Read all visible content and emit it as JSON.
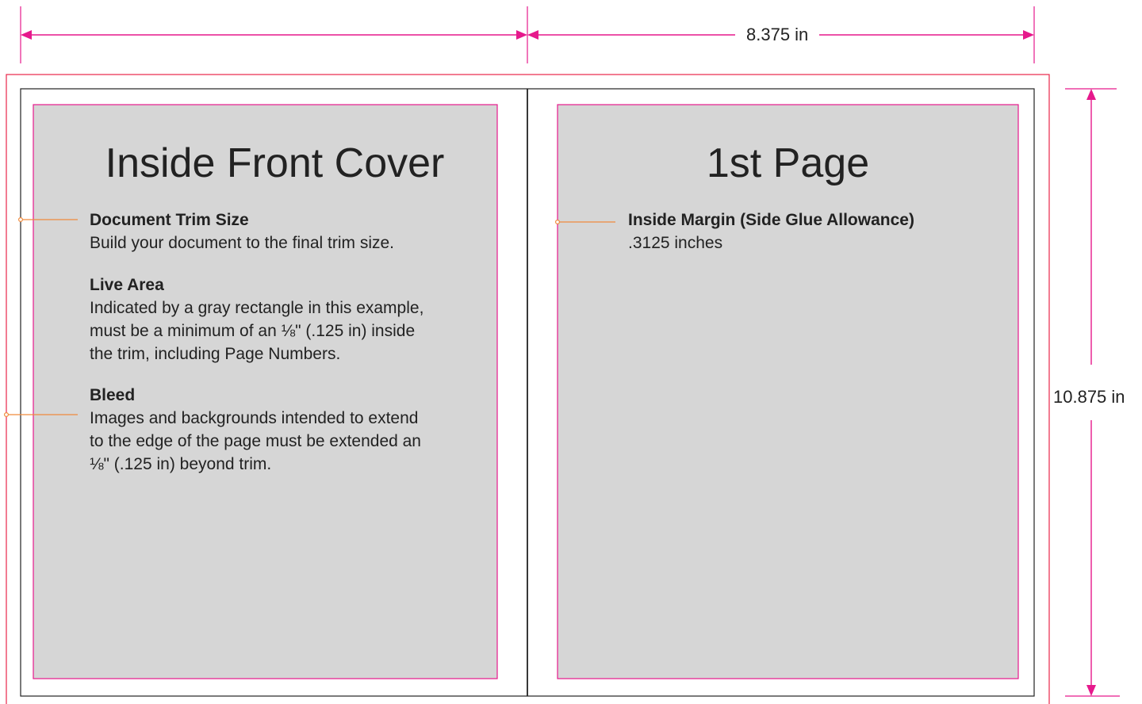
{
  "colors": {
    "dimension": "#e6198c",
    "bleed": "#e8254a",
    "trim": "#222222",
    "live_area": "#e6198c",
    "live_fill": "#d6d6d6",
    "callout": "#f08a3c"
  },
  "dimensions": {
    "width_label": "8.375 in",
    "height_label": "10.875 in"
  },
  "left_page": {
    "title": "Inside Front Cover",
    "blocks": [
      {
        "heading": "Document Trim Size",
        "lines": [
          "Build your document to the final trim size."
        ]
      },
      {
        "heading": "Live Area",
        "lines": [
          "Indicated by a gray rectangle in this example,",
          "must be a minimum of an ⅛\" (.125 in) inside",
          "the trim, including Page Numbers."
        ]
      },
      {
        "heading": "Bleed",
        "lines": [
          "Images and backgrounds intended to extend",
          "to the edge of the page must be extended an",
          "⅛\" (.125 in) beyond trim."
        ]
      }
    ]
  },
  "right_page": {
    "title": "1st Page",
    "blocks": [
      {
        "heading": "Inside Margin (Side Glue Allowance)",
        "lines": [
          ".3125 inches"
        ]
      }
    ]
  }
}
